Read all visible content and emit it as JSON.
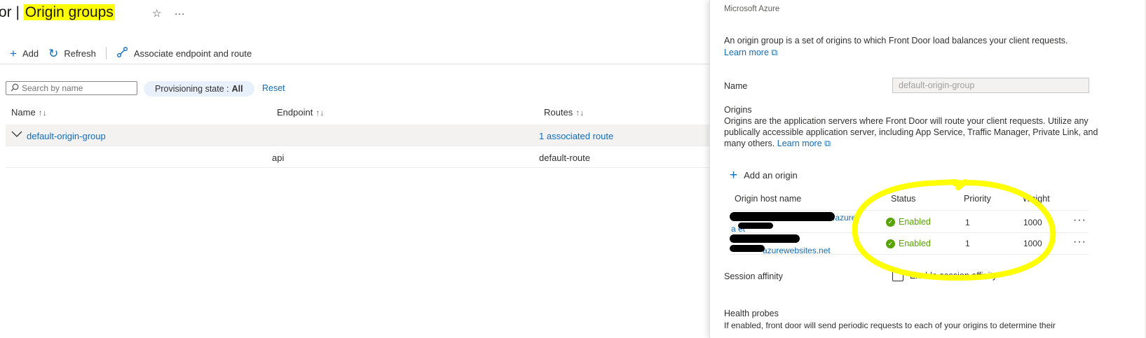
{
  "page": {
    "title_prefix": "or | ",
    "title_highlight": "Origin groups",
    "star_icon": "☆",
    "more_icon": "···"
  },
  "toolbar": {
    "add_label": "Add",
    "refresh_label": "Refresh",
    "associate_label": "Associate endpoint and route"
  },
  "filters": {
    "search_placeholder": "Search by name",
    "provisioning_label": "Provisioning state :",
    "provisioning_value": "All",
    "reset_label": "Reset"
  },
  "table": {
    "columns": [
      "Name",
      "Endpoint",
      "Routes"
    ],
    "sort_glyph": "↑↓",
    "group_row": {
      "name": "default-origin-group",
      "routes": "1 associated route"
    },
    "sub_row": {
      "endpoint": "api",
      "route": "default-route"
    }
  },
  "panel": {
    "subtitle": "Microsoft Azure",
    "description": "An origin group is a set of origins to which Front Door load balances your client requests.",
    "learn_more": "Learn more",
    "name_label": "Name",
    "name_value": "default-origin-group",
    "origins_heading": "Origins",
    "origins_description": "Origins are the application servers where Front Door will route your client requests. Utilize any publically accessible application server, including App Service, Traffic Manager, Private Link, and many others.",
    "origins_learn_more": "Learn more",
    "add_origin_label": "Add an origin",
    "origin_columns": {
      "host": "Origin host name",
      "status": "Status",
      "priority": "Priority",
      "weight": "Weight"
    },
    "origins": [
      {
        "host_visible": ".azure-",
        "host_line2": "a  et",
        "status": "Enabled",
        "priority": "1",
        "weight": "1000"
      },
      {
        "host_visible": "azurewebsites.net",
        "status": "Enabled",
        "priority": "1",
        "weight": "1000"
      }
    ],
    "session_affinity_label": "Session affinity",
    "session_affinity_checkbox": "Enable session affinity",
    "health_probes_label": "Health probes",
    "health_probes_text": "If enabled, front door will send periodic requests to each of your origins to determine their"
  },
  "colors": {
    "accent": "#0f6cbd",
    "enabled": "#57a300",
    "highlight": "#ffff00"
  }
}
